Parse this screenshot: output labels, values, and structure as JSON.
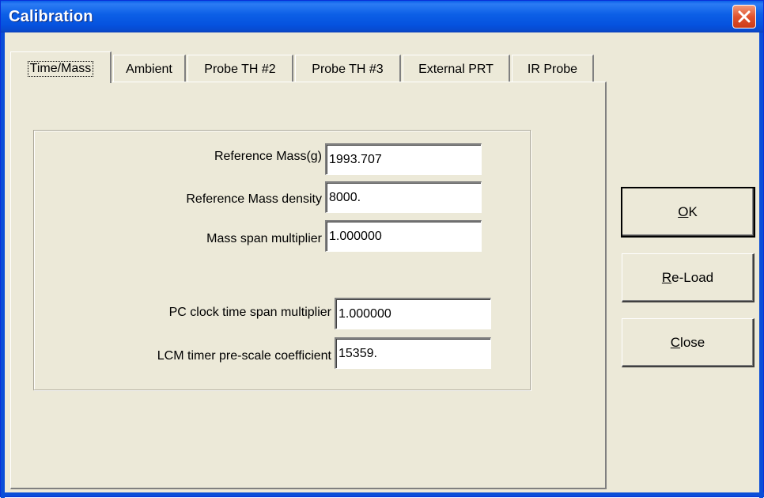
{
  "window": {
    "title": "Calibration",
    "close_icon": "close-icon"
  },
  "tabs": [
    {
      "label": "Time/Mass",
      "active": true
    },
    {
      "label": "Ambient",
      "active": false
    },
    {
      "label": "Probe TH #2",
      "active": false
    },
    {
      "label": "Probe TH #3",
      "active": false
    },
    {
      "label": "External PRT",
      "active": false
    },
    {
      "label": "IR Probe",
      "active": false
    }
  ],
  "fields": {
    "reference_mass": {
      "label": "Reference Mass(g)",
      "value": "1993.707"
    },
    "reference_mass_density": {
      "label": "Reference Mass density",
      "value": "8000."
    },
    "mass_span_multiplier": {
      "label": "Mass span multiplier",
      "value": "1.000000"
    },
    "pc_clock_time_span_multiplier": {
      "label": "PC clock time span multiplier",
      "value": "1.000000"
    },
    "lcm_timer_prescale_coefficient": {
      "label": "LCM timer pre-scale coefficient",
      "value": "15359."
    }
  },
  "buttons": {
    "ok": {
      "mnemonic": "O",
      "rest": "K"
    },
    "reload": {
      "mnemonic": "R",
      "rest": "e-Load"
    },
    "close": {
      "mnemonic": "C",
      "rest": "lose"
    }
  },
  "colors": {
    "titlebar": "#0A5FE8",
    "dialog_face": "#ECE9D8",
    "close_button": "#E0532F"
  }
}
